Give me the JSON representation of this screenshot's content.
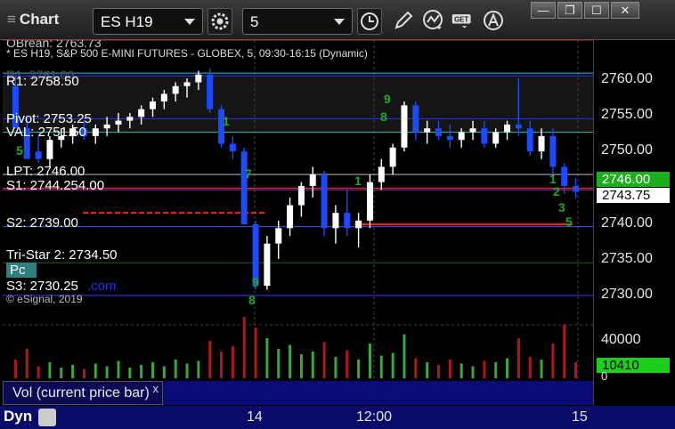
{
  "window": {
    "title": "Chart",
    "symbol": "ES H19",
    "interval": "5",
    "controls": {
      "minimize": "—",
      "restore": "❐",
      "maximize": "☐",
      "close": "✕"
    }
  },
  "toolbar_icons": [
    "settings-icon",
    "clock-icon",
    "pencil-icon",
    "study-icon",
    "get-icon",
    "alert-icon"
  ],
  "chart": {
    "header": "* ES H19, S&P 500 E-MINI FUTURES - GLOBEX, 5, 09:30-16:15 (Dynamic)",
    "copyright": "© eSignal, 2019",
    "truncated_top": "OBrean: 2763.73",
    "overlay_labels": {
      "r1": "R1: 2758.50",
      "pivot": "Pivot: 2753.25",
      "val": "VAL: 2751.50",
      "lpt": "LPT: 2746.00",
      "s1": "S1: 2744.254.00",
      "s2": "S2: 2739.00",
      "tristar": "Tri-Star 2: 2734.50",
      "pc": "Pc",
      "s3": "S3: 2730.25",
      "com": ".com",
      "hidden_top": "R1: 2761.00"
    },
    "price_axis": [
      "2760.00",
      "2755.00",
      "2750.00",
      "2746.00",
      "2743.75",
      "2740.00",
      "2735.00",
      "2730.00"
    ],
    "last_price": "2743.75",
    "lpt_price": "2746.00",
    "volume_axis": [
      "40000",
      "0"
    ],
    "volume_value": "10410",
    "volume_legend": "Vol (current price bar)",
    "legend_close": "x",
    "time_axis": [
      "14",
      "12:00",
      "15"
    ],
    "dyn_label": "Dyn",
    "seq_markers": [
      "9",
      "8",
      "1",
      "5",
      "9",
      "8",
      "1",
      "7",
      "1",
      "2",
      "3",
      "5",
      "9",
      "8"
    ],
    "colors": {
      "up_candle": "#ffffff",
      "down_candle": "#1a4bff",
      "r1_line": "#2aa7d6",
      "pivot_line": "#2a2aff",
      "val_line": "#29b39b",
      "lpt_line": "#ffffff",
      "s1_line": "#ff2020",
      "s2_dash": "#ff2020",
      "s3_line": "#3a3aff",
      "tristar_line": "#1f5f1f",
      "vol_up": "#3aa83a",
      "vol_down": "#b01818",
      "lpt_tag": "#1bb01b",
      "vol_tag": "#1bd01b"
    },
    "candles": [
      [
        2757.5,
        2759,
        2755,
        2752
      ],
      [
        2752,
        2753.5,
        2749,
        2748
      ],
      [
        2749,
        2751,
        2747.5,
        2748
      ],
      [
        2748,
        2751,
        2747,
        2750.5
      ],
      [
        2750.5,
        2752,
        2749.5,
        2751
      ],
      [
        2751,
        2752.5,
        2750,
        2752
      ],
      [
        2752,
        2753,
        2750.5,
        2751
      ],
      [
        2751,
        2752.5,
        2750,
        2752
      ],
      [
        2752,
        2753.5,
        2751,
        2752.5
      ],
      [
        2752.5,
        2754,
        2751.5,
        2753
      ],
      [
        2753,
        2754,
        2752,
        2753.5
      ],
      [
        2753.5,
        2755,
        2752.5,
        2754.5
      ],
      [
        2754.5,
        2756,
        2753.5,
        2755.5
      ],
      [
        2755.5,
        2757,
        2754.5,
        2756.5
      ],
      [
        2756.5,
        2758,
        2755.5,
        2757.5
      ],
      [
        2757.5,
        2758.5,
        2756,
        2758
      ],
      [
        2758,
        2759.5,
        2757,
        2759
      ],
      [
        2759,
        2759.8,
        2754,
        2754.5
      ],
      [
        2754.5,
        2755,
        2749.5,
        2750
      ],
      [
        2750,
        2751,
        2748,
        2749
      ],
      [
        2749,
        2749.5,
        2740,
        2739.5
      ],
      [
        2739.5,
        2740,
        2731,
        2731.5
      ],
      [
        2731.5,
        2738,
        2731,
        2737
      ],
      [
        2737,
        2740,
        2735,
        2739
      ],
      [
        2739,
        2743,
        2738,
        2742
      ],
      [
        2742,
        2745,
        2740.5,
        2744.5
      ],
      [
        2744.5,
        2747,
        2743,
        2746
      ],
      [
        2746,
        2746.5,
        2738,
        2739
      ],
      [
        2739,
        2742,
        2737,
        2741
      ],
      [
        2741,
        2744,
        2738,
        2739
      ],
      [
        2739,
        2741,
        2736.5,
        2740
      ],
      [
        2740,
        2746,
        2739,
        2745
      ],
      [
        2745,
        2748,
        2744,
        2747
      ],
      [
        2747,
        2750,
        2746,
        2749.5
      ],
      [
        2749.5,
        2755.5,
        2749,
        2755
      ],
      [
        2755,
        2755.5,
        2750.5,
        2751.5
      ],
      [
        2751.5,
        2753,
        2750,
        2752
      ],
      [
        2752,
        2753,
        2750.5,
        2751
      ],
      [
        2751,
        2752.5,
        2749.5,
        2750.5
      ],
      [
        2750.5,
        2752,
        2749.5,
        2751.5
      ],
      [
        2751.5,
        2753,
        2750.5,
        2752
      ],
      [
        2752,
        2753,
        2749.5,
        2750
      ],
      [
        2750,
        2752,
        2749.5,
        2751.5
      ],
      [
        2751.5,
        2753,
        2750.5,
        2752.5
      ],
      [
        2752.5,
        2758.5,
        2751,
        2752
      ],
      [
        2752,
        2753,
        2748.5,
        2749
      ],
      [
        2749,
        2752,
        2748,
        2751
      ],
      [
        2751,
        2752,
        2746,
        2747
      ],
      [
        2747,
        2747.5,
        2743.5,
        2744.5
      ],
      [
        2744.5,
        2745.5,
        2743,
        2743.75
      ]
    ],
    "volumes": [
      14,
      22,
      9,
      12,
      8,
      10,
      7,
      11,
      9,
      13,
      8,
      10,
      12,
      9,
      14,
      11,
      13,
      28,
      20,
      24,
      46,
      38,
      30,
      22,
      25,
      18,
      20,
      27,
      16,
      21,
      14,
      26,
      17,
      19,
      33,
      15,
      12,
      10,
      14,
      11,
      9,
      13,
      12,
      15,
      30,
      16,
      14,
      26,
      40,
      12
    ]
  }
}
